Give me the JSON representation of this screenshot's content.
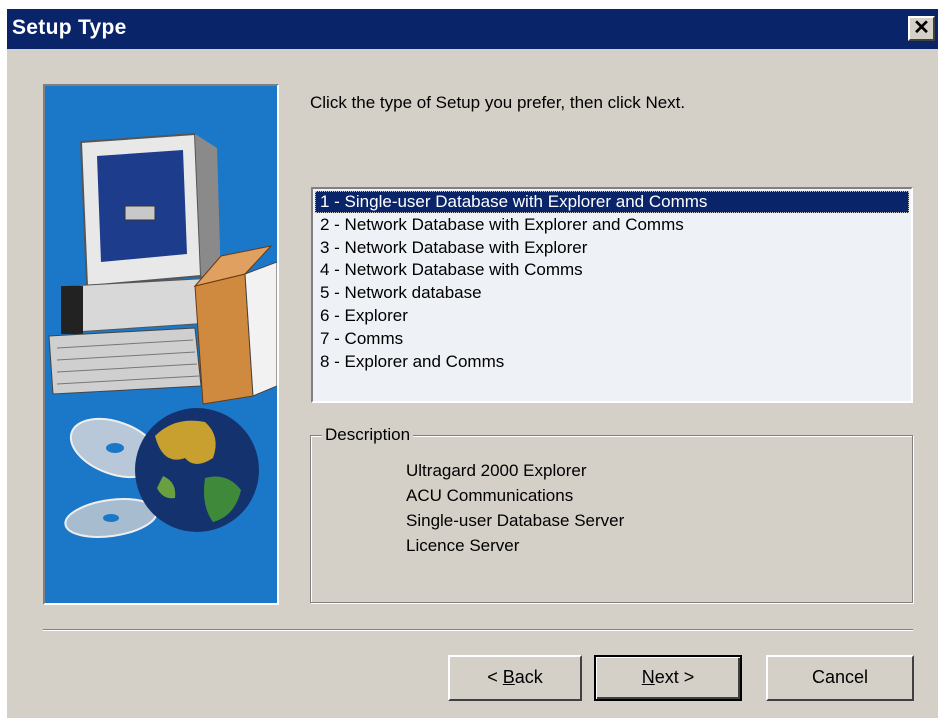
{
  "window": {
    "title": "Setup Type",
    "close_icon": "close-icon",
    "colors": {
      "titlebar": "#0a246a",
      "face": "#d4d0c8",
      "selection": "#0a246a",
      "panel": "#1b78c9"
    }
  },
  "instruction": "Click the type of Setup you prefer, then click Next.",
  "setup_options": {
    "selected_index": 0,
    "items": [
      "1 - Single-user Database with Explorer and Comms",
      "2 - Network Database with Explorer and Comms",
      "3 - Network Database with Explorer",
      "4 - Network Database with Comms",
      "5 - Network database",
      "6 - Explorer",
      "7 - Comms",
      "8 - Explorer and Comms"
    ]
  },
  "description": {
    "legend": "Description",
    "lines": [
      "Ultragard 2000 Explorer",
      "ACU Communications",
      "Single-user Database Server",
      "Licence Server"
    ]
  },
  "buttons": {
    "back": {
      "prefix": "< ",
      "mnemonic": "B",
      "rest": "ack"
    },
    "next": {
      "mnemonic": "N",
      "rest": "ext >"
    },
    "cancel": "Cancel"
  },
  "illustration": {
    "icons": [
      "computer-icon",
      "box-icon",
      "cd-icon",
      "globe-icon"
    ]
  }
}
